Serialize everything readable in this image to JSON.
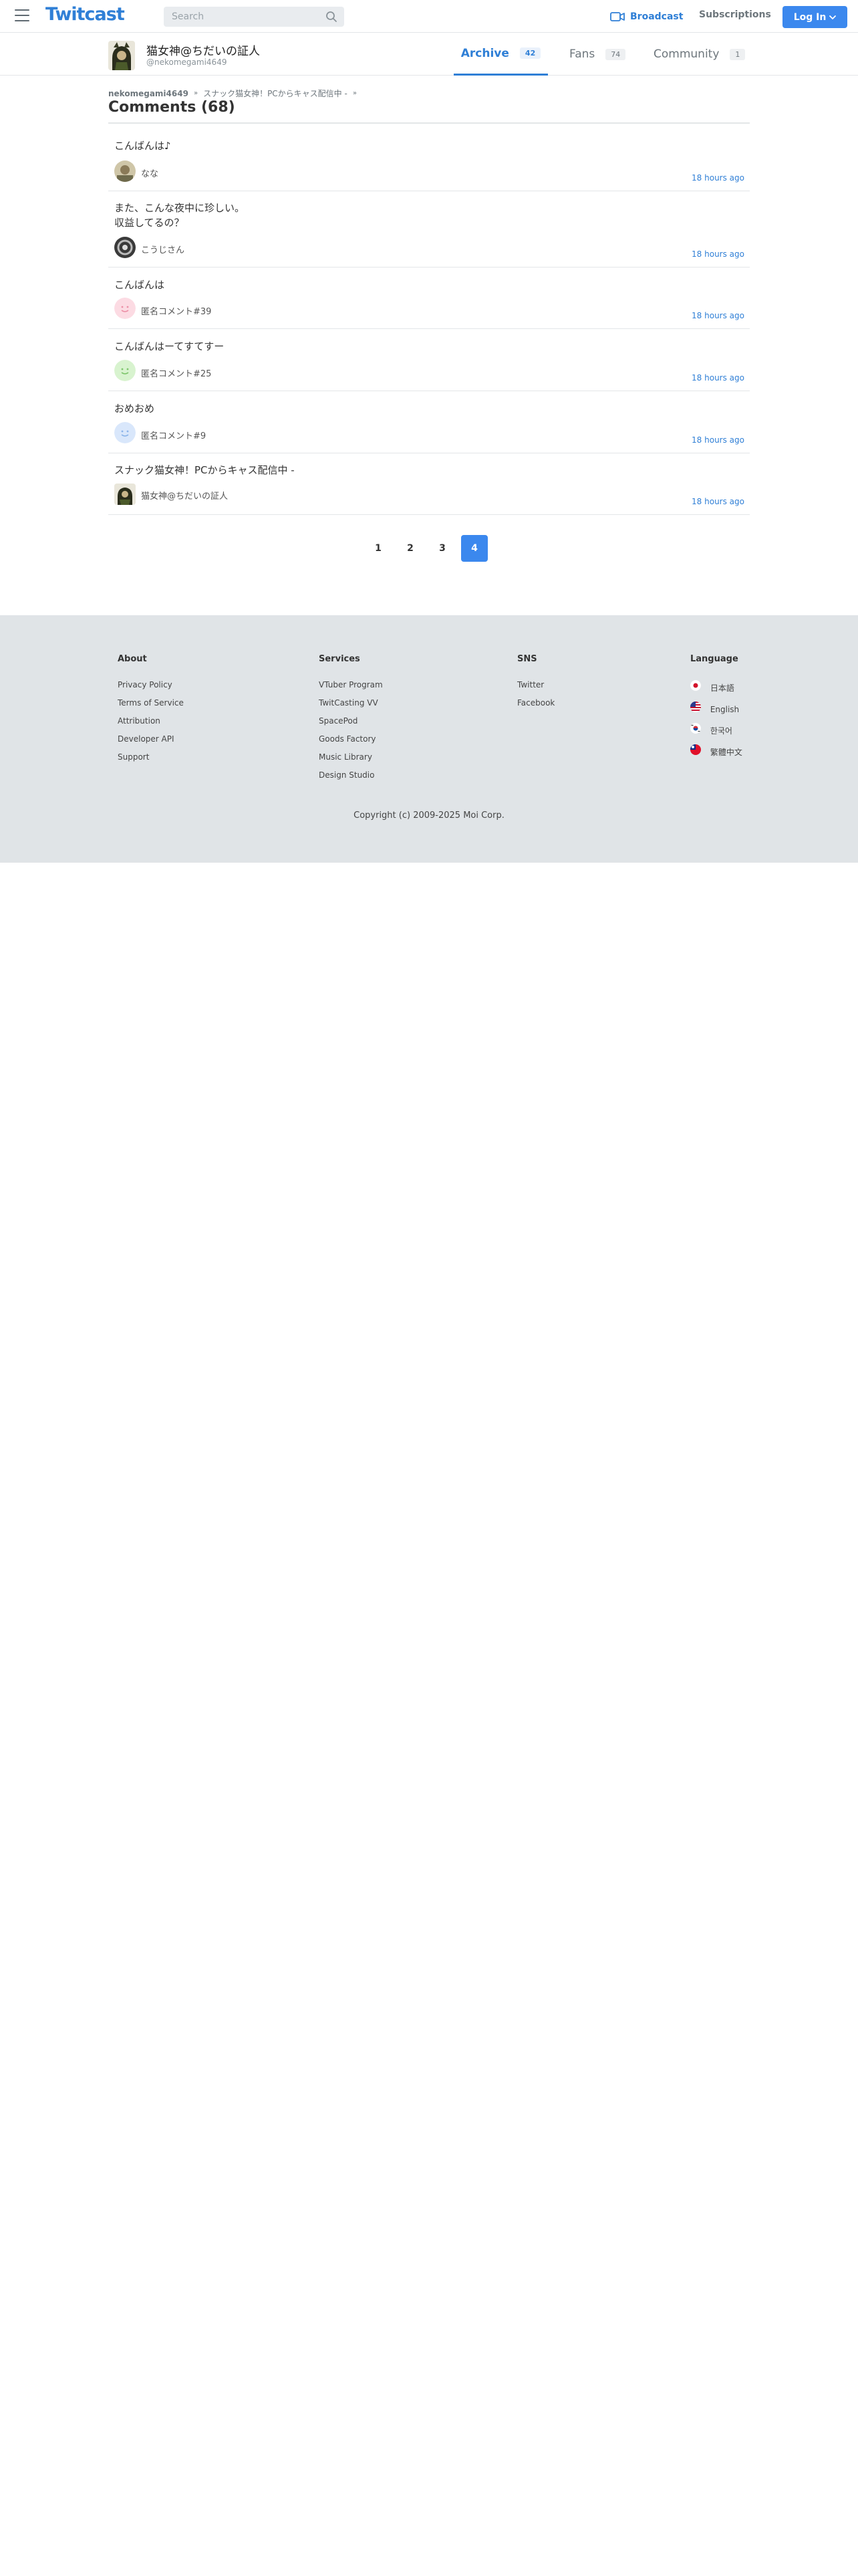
{
  "header": {
    "logo": "Twitcast",
    "search_placeholder": "Search",
    "broadcast_label": "Broadcast",
    "subscriptions_label": "Subscriptions",
    "login_label": "Log In",
    "accent_color": "#3b88ee"
  },
  "user": {
    "name": "猫女神@ちだいの証人",
    "id": "@nekomegami4649",
    "tabs": [
      {
        "label": "Archive",
        "count": "42"
      },
      {
        "label": "Fans",
        "count": "74"
      },
      {
        "label": "Community",
        "count": "1"
      }
    ]
  },
  "breadcrumb": {
    "home": "nekomegami4649",
    "item": "スナック猫女神！PCからキャス配信中 -"
  },
  "comments_title": "Comments (68)",
  "comments": [
    {
      "text": "こんばんは♪",
      "author": "なな",
      "time": "18 hours ago"
    },
    {
      "text_line1": "また、こんな夜中に珍しい。",
      "text_line2": "収益してるの？",
      "author": "こうじさん",
      "time": "18 hours ago"
    },
    {
      "text": "こんばんは",
      "author": "匿名コメント#39",
      "time": "18 hours ago"
    },
    {
      "text": "こんばんはーてすてすー",
      "author": "匿名コメント#25",
      "time": "18 hours ago"
    },
    {
      "text": "おめおめ",
      "author": "匿名コメント#9",
      "time": "18 hours ago"
    },
    {
      "text": "スナック猫女神！PCからキャス配信中 -",
      "author": "猫女神@ちだいの証人",
      "time": "18 hours ago"
    }
  ],
  "pagination": {
    "pages": [
      "1",
      "2",
      "3",
      "4"
    ],
    "current": "4"
  },
  "footer": {
    "about": {
      "title": "About",
      "links": [
        "Privacy Policy",
        "Terms of Service",
        "Attribution",
        "Developer API",
        "Support"
      ]
    },
    "services": {
      "title": "Services",
      "links": [
        "VTuber Program",
        "TwitCasting VV",
        "SpacePod",
        "Goods Factory",
        "Music Library",
        "Design Studio"
      ]
    },
    "sns": {
      "title": "SNS",
      "links": [
        "Twitter",
        "Facebook"
      ]
    },
    "language": {
      "title": "Language",
      "items": [
        "日本語",
        "English",
        "한국어",
        "繁體中文"
      ]
    },
    "copyright": "Copyright (c) 2009-2025 Moi Corp."
  }
}
